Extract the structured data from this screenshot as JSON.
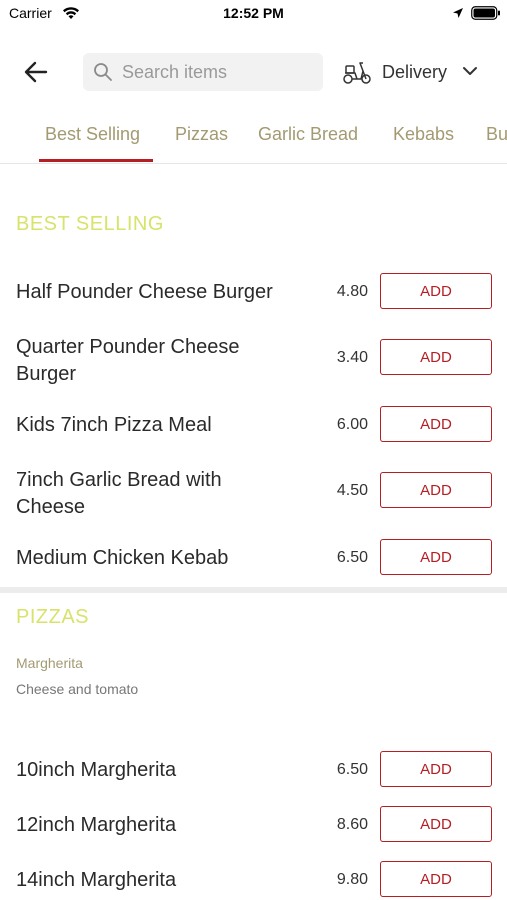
{
  "status_bar": {
    "carrier": "Carrier",
    "time": "12:52 PM"
  },
  "header": {
    "search_placeholder": "Search items",
    "delivery_label": "Delivery"
  },
  "tabs": [
    {
      "label": "Best Selling",
      "active": true
    },
    {
      "label": "Pizzas",
      "active": false
    },
    {
      "label": "Garlic Bread",
      "active": false
    },
    {
      "label": "Kebabs",
      "active": false
    },
    {
      "label": "Bu",
      "active": false
    }
  ],
  "sections": {
    "best_selling": {
      "title": "BEST SELLING",
      "items": [
        {
          "name": "Half Pounder Cheese Burger",
          "price": "4.80"
        },
        {
          "name": "Quarter Pounder Cheese Burger",
          "price": "3.40"
        },
        {
          "name": "Kids 7inch Pizza Meal",
          "price": "6.00"
        },
        {
          "name": "7inch Garlic Bread with Cheese",
          "price": "4.50"
        },
        {
          "name": "Medium Chicken Kebab",
          "price": "6.50"
        }
      ]
    },
    "pizzas": {
      "title": "PIZZAS",
      "subgroup_title": "Margherita",
      "subgroup_description": "Cheese and tomato",
      "items": [
        {
          "name": "10inch Margherita",
          "price": "6.50"
        },
        {
          "name": "12inch Margherita",
          "price": "8.60"
        },
        {
          "name": "14inch Margherita",
          "price": "9.80"
        }
      ]
    }
  },
  "add_label": "ADD",
  "colors": {
    "accent": "#b51f24",
    "section_title": "#d7e36a",
    "tab_text": "#a39a72"
  }
}
